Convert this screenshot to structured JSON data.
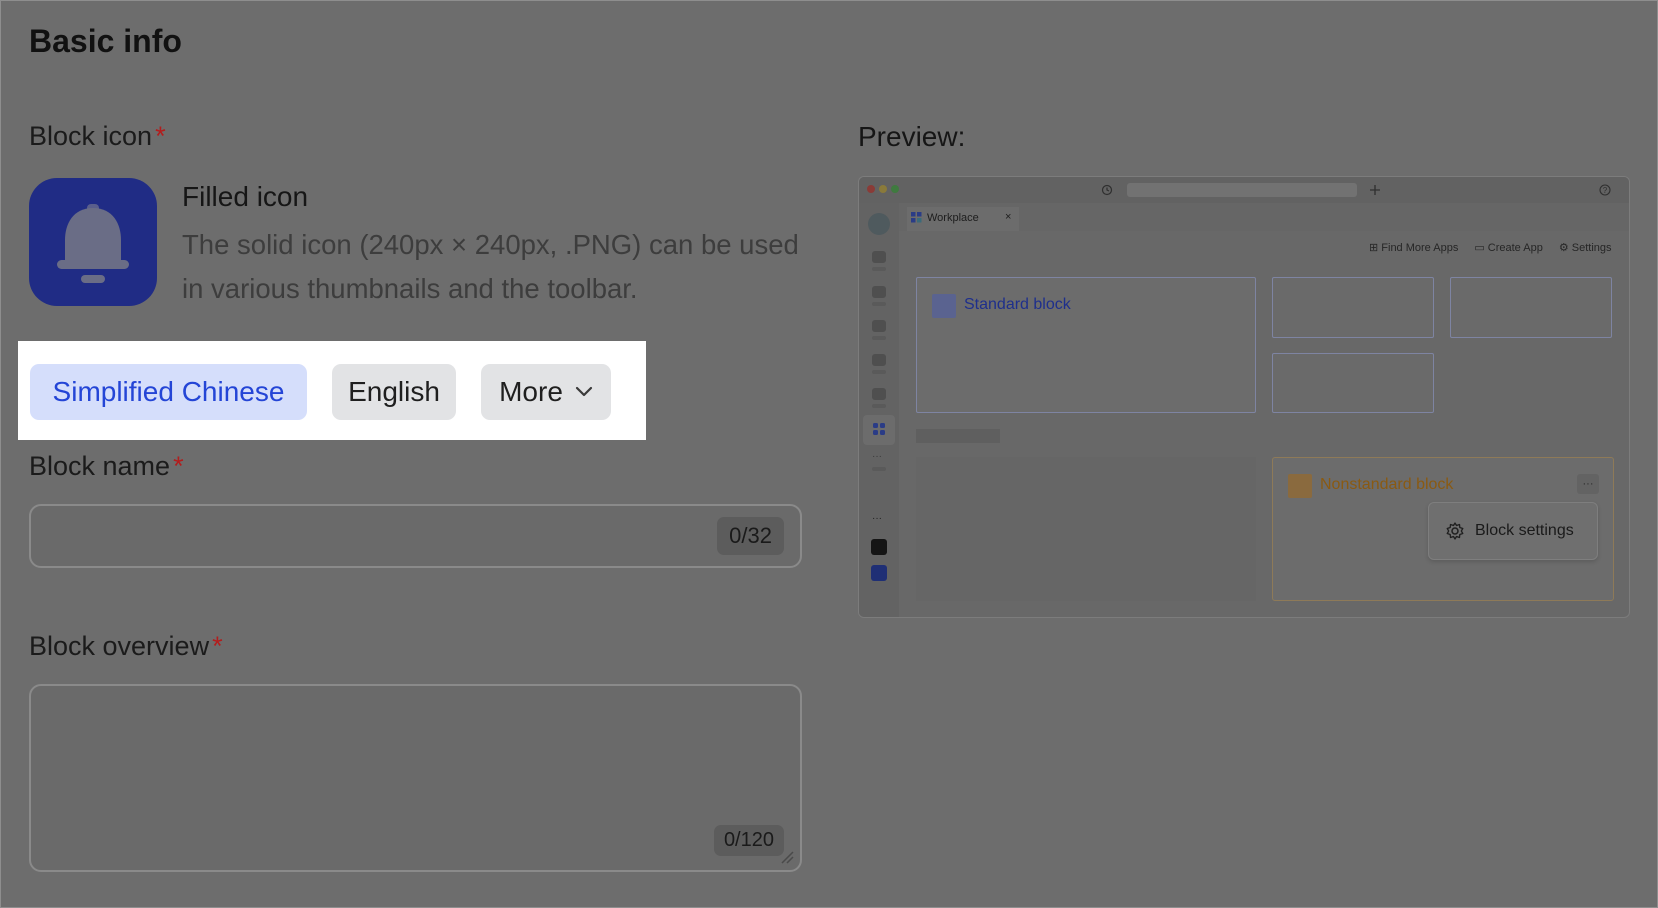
{
  "page": {
    "title": "Basic info"
  },
  "block_icon": {
    "label": "Block icon",
    "required_mark": "*",
    "icon_name": "bell-icon",
    "filled_title": "Filled icon",
    "filled_desc": "The solid icon (240px × 240px, .PNG) can be used in various thumbnails and the toolbar."
  },
  "languages": {
    "active": "Simplified Chinese",
    "english": "English",
    "more": "More"
  },
  "block_name": {
    "label": "Block name",
    "required_mark": "*",
    "value": "",
    "counter": "0/32"
  },
  "block_overview": {
    "label": "Block overview",
    "required_mark": "*",
    "value": "",
    "counter": "0/120"
  },
  "preview": {
    "label": "Preview:",
    "tab": "Workplace",
    "actions": [
      "Find More Apps",
      "Create App",
      "Settings"
    ],
    "standard_block": "Standard block",
    "nonstandard_block": "Nonstandard block",
    "block_settings": "Block settings",
    "more_dots": "···"
  },
  "colors": {
    "overlay": "#6d6d6d",
    "accent": "#2445d6",
    "chip_active_bg": "#d5defb",
    "required": "#b31d1d",
    "icon_bg": "#202c85",
    "nonstandard_text": "#8a5a12"
  }
}
